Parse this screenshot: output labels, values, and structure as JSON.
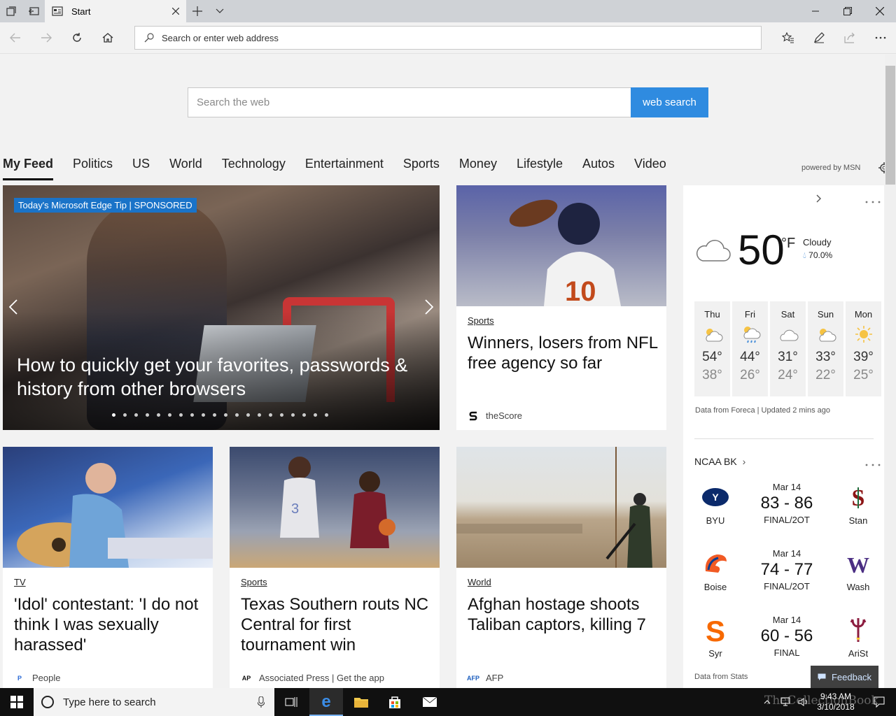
{
  "browser": {
    "tab_title": "Start",
    "address_placeholder": "Search or enter web address"
  },
  "search": {
    "placeholder": "Search the web",
    "button": "web search"
  },
  "feed_nav": {
    "tabs": [
      "My Feed",
      "Politics",
      "US",
      "World",
      "Technology",
      "Entertainment",
      "Sports",
      "Money",
      "Lifestyle",
      "Autos",
      "Video"
    ],
    "powered_by": "powered by MSN"
  },
  "hero": {
    "badge": "Today's Microsoft Edge Tip | SPONSORED",
    "title": "How to quickly get your favorites, passwords & history from other browsers",
    "dot_count": 20,
    "active_dot": 0
  },
  "cards": [
    {
      "category": "Sports",
      "title": "Winners, losers from NFL free agency so far",
      "source": "theScore"
    },
    {
      "category": "TV",
      "title": "'Idol' contestant: 'I do not think I was sexually harassed'",
      "source": "People"
    },
    {
      "category": "Sports",
      "title": "Texas Southern routs NC Central for first tournament win",
      "source": "Associated Press | Get the app"
    },
    {
      "category": "World",
      "title": "Afghan hostage shoots Taliban captors, killing 7",
      "source": "AFP"
    }
  ],
  "weather": {
    "temp": "50",
    "unit": "°F",
    "condition": "Cloudy",
    "precip": "70.0%",
    "days": [
      {
        "name": "Thu",
        "hi": "54°",
        "lo": "38°",
        "icon": "partly-sunny-icon"
      },
      {
        "name": "Fri",
        "hi": "44°",
        "lo": "26°",
        "icon": "rain-icon"
      },
      {
        "name": "Sat",
        "hi": "31°",
        "lo": "24°",
        "icon": "cloud-icon"
      },
      {
        "name": "Sun",
        "hi": "33°",
        "lo": "22°",
        "icon": "partly-sunny-icon"
      },
      {
        "name": "Mon",
        "hi": "39°",
        "lo": "25°",
        "icon": "sun-icon"
      }
    ],
    "source": "Data from Foreca | Updated 2 mins ago"
  },
  "scores": {
    "title": "NCAA BK",
    "games": [
      {
        "date": "Mar 14",
        "score": "83 - 86",
        "status": "FINAL/2OT",
        "team1": "BYU",
        "team2": "Stan",
        "color1": "#0b2a6b",
        "color2": "#8c1515"
      },
      {
        "date": "Mar 14",
        "score": "74 - 77",
        "status": "FINAL/2OT",
        "team1": "Boise",
        "team2": "Wash",
        "color1": "#0a3d91",
        "color2": "#4b2e83"
      },
      {
        "date": "Mar 14",
        "score": "60 - 56",
        "status": "FINAL",
        "team1": "Syr",
        "team2": "AriSt",
        "color1": "#f76900",
        "color2": "#8c1d40"
      }
    ],
    "source": "Data from Stats"
  },
  "feedback": "Feedback",
  "taskbar": {
    "search_placeholder": "Type here to search",
    "time": "9:43 AM",
    "date": "3/10/2018",
    "watermark": "TheCollectionBook"
  },
  "colors": {
    "accent": "#2f8be0",
    "badge": "#1a73c8"
  }
}
